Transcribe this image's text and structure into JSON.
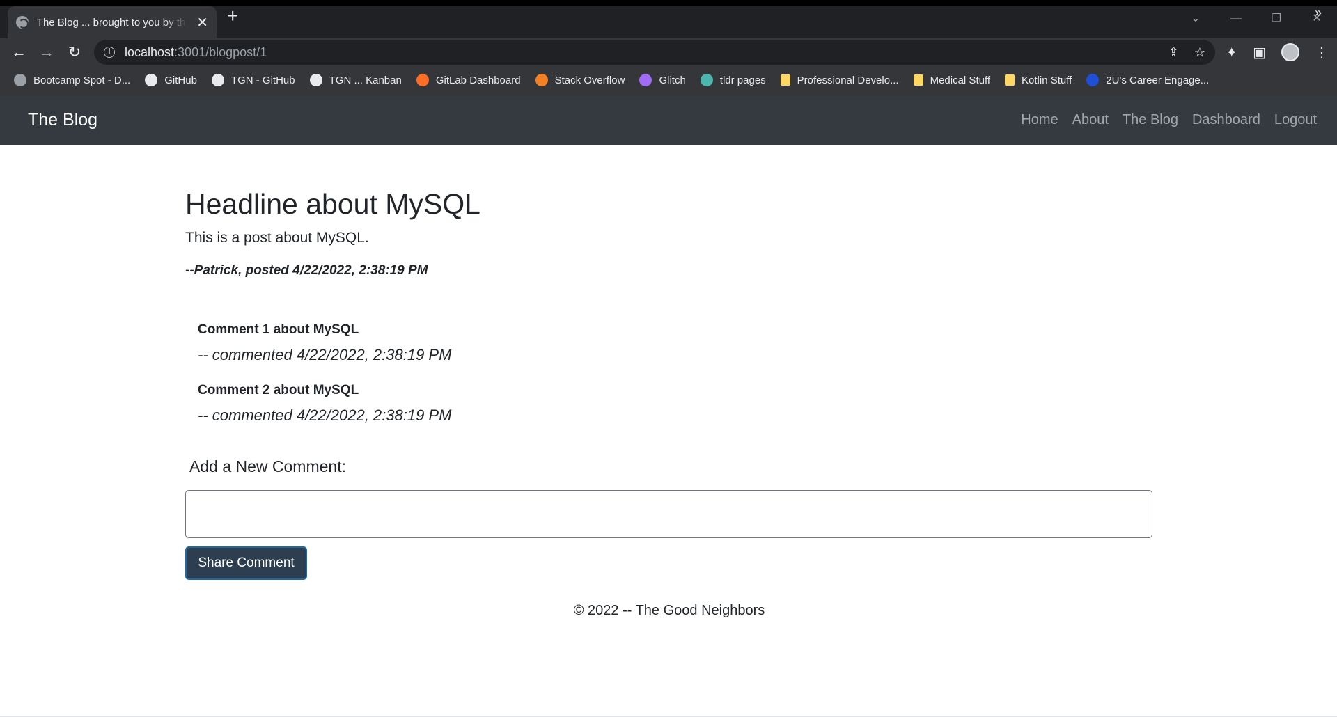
{
  "browser": {
    "tab_title": "The Blog ... brought to you by the Good Neighbors",
    "url_host": "localhost",
    "url_path": ":3001/blogpost/1",
    "bookmarks": [
      {
        "label": "Bootcamp Spot - D...",
        "icon": "globe-icon",
        "color": "#9aa0a6"
      },
      {
        "label": "GitHub",
        "icon": "github-icon",
        "color": "#e8eaed"
      },
      {
        "label": "TGN - GitHub",
        "icon": "github-icon",
        "color": "#e8eaed"
      },
      {
        "label": "TGN ... Kanban",
        "icon": "github-icon",
        "color": "#e8eaed"
      },
      {
        "label": "GitLab Dashboard",
        "icon": "gitlab-icon",
        "color": "#fc6d26"
      },
      {
        "label": "Stack Overflow",
        "icon": "stackoverflow-icon",
        "color": "#f48024"
      },
      {
        "label": "Glitch",
        "icon": "glitch-icon",
        "color": "#a06bf5"
      },
      {
        "label": "tldr pages",
        "icon": "tldr-icon",
        "color": "#4db6ac"
      },
      {
        "label": "Professional Develo...",
        "icon": "folder-icon",
        "color": "#fdd663"
      },
      {
        "label": "Medical Stuff",
        "icon": "folder-icon",
        "color": "#fdd663"
      },
      {
        "label": "Kotlin Stuff",
        "icon": "folder-icon",
        "color": "#fdd663"
      },
      {
        "label": "2U's Career Engage...",
        "icon": "2u-icon",
        "color": "#1f4fd6"
      }
    ]
  },
  "navbar": {
    "brand": "The Blog",
    "links": [
      "Home",
      "About",
      "The Blog",
      "Dashboard",
      "Logout"
    ]
  },
  "post": {
    "title": "Headline about MySQL",
    "body": "This is a post about MySQL.",
    "meta": "--Patrick, posted 4/22/2022, 2:38:19 PM"
  },
  "comments": [
    {
      "text": "Comment 1 about MySQL",
      "meta": "-- commented 4/22/2022, 2:38:19 PM"
    },
    {
      "text": "Comment 2 about MySQL",
      "meta": "-- commented 4/22/2022, 2:38:19 PM"
    }
  ],
  "new_comment": {
    "label": "Add a New Comment:",
    "value": "",
    "button_label": "Share Comment"
  },
  "footer": {
    "text": "© 2022 -- The Good Neighbors"
  },
  "colors": {
    "navbar_bg": "#343a40",
    "button_bg": "#2c3e50",
    "chrome_bg": "#35363a"
  }
}
